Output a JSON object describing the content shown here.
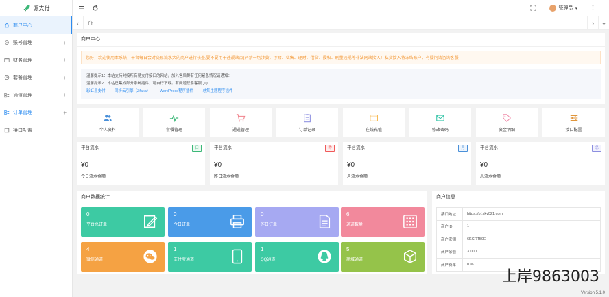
{
  "sidebar": {
    "logo": "源支付",
    "items": [
      {
        "label": "商户中心",
        "plus": ""
      },
      {
        "label": "账号管理",
        "plus": "+"
      },
      {
        "label": "财务管理",
        "plus": "+"
      },
      {
        "label": "套餐管理",
        "plus": "+"
      },
      {
        "label": "通道管理",
        "plus": "+"
      },
      {
        "label": "订单管理",
        "plus": "+"
      },
      {
        "label": "接口配置",
        "plus": ""
      }
    ]
  },
  "topbar": {
    "user": "管理员",
    "caret": "▾"
  },
  "tabbar": {
    "left": "‹",
    "right": "›",
    "down": "⌄"
  },
  "main": {
    "title": "商户中心",
    "notice": "您好，欢迎使用本系统，平台每日会对交易流水大的商户进行核查,要不要用于违规站点(严禁一切涉黄、涉赌、私售、理财、借贷、授权、刷量违规等非法网站接入！私货接入将冻结账户，有疑问请咨询客服",
    "tip1": "温馨提示1：本站支持对接所有易支付接口的网站，加入售后群有任何紧急情况请通知：",
    "tip2": "温馨提示2：本站已集成部分系统插件，可自行下载。有问题联系客服QQ：",
    "links": [
      "彩虹易支付",
      "同析云引擎（Zfaka）",
      "WordPress程序插件",
      "总集主题程序插件"
    ]
  },
  "quick": [
    {
      "label": "个人资料",
      "icon": "users-icon",
      "color": "#4a90d9"
    },
    {
      "label": "套餐管理",
      "icon": "pulse-icon",
      "color": "#3cb878"
    },
    {
      "label": "通道管理",
      "icon": "cart-icon",
      "color": "#f0808a"
    },
    {
      "label": "订单记录",
      "icon": "clipboard-icon",
      "color": "#8c8fe0"
    },
    {
      "label": "在线充值",
      "icon": "window-icon",
      "color": "#f5a623"
    },
    {
      "label": "修改密码",
      "icon": "mail-icon",
      "color": "#2fc4a6"
    },
    {
      "label": "资金明细",
      "icon": "tag-icon",
      "color": "#f08aa8"
    },
    {
      "label": "接口配置",
      "icon": "sliders-icon",
      "color": "#e0963c"
    }
  ],
  "stats": [
    {
      "title": "平台流水",
      "badge": "日",
      "badge_color": "#3cb878",
      "value": "¥0",
      "desc": "今日流水金额"
    },
    {
      "title": "平台流水",
      "badge": "昨",
      "badge_color": "#f05a5a",
      "value": "¥0",
      "desc": "昨日流水金额"
    },
    {
      "title": "平台流水",
      "badge": "月",
      "badge_color": "#4a90d9",
      "value": "¥0",
      "desc": "月流水金额"
    },
    {
      "title": "平台流水",
      "badge": "总",
      "badge_color": "#8c8fe0",
      "value": "¥0",
      "desc": "总流水金额"
    }
  ],
  "data_panel": {
    "title": "商户数据统计",
    "tiles": [
      {
        "num": "0",
        "label": "平台总订单",
        "color": "#3dcaa3",
        "icon": "edit-icon"
      },
      {
        "num": "0",
        "label": "今日订单",
        "color": "#4a9be8",
        "icon": "printer-icon"
      },
      {
        "num": "0",
        "label": "昨日订单",
        "color": "#a6a9f2",
        "icon": "document-icon"
      },
      {
        "num": "6",
        "label": "通道数量",
        "color": "#f2899c",
        "icon": "grid-icon"
      },
      {
        "num": "4",
        "label": "微信通道",
        "color": "#f5a243",
        "icon": "wechat-icon"
      },
      {
        "num": "1",
        "label": "支付宝通道",
        "color": "#3dcaa3",
        "icon": "tablet-icon"
      },
      {
        "num": "1",
        "label": "QQ通道",
        "color": "#3dcaa3",
        "icon": "qq-icon"
      },
      {
        "num": "5",
        "label": "商城通道",
        "color": "#95c34a",
        "icon": "box-icon"
      }
    ]
  },
  "info_panel": {
    "title": "商户信息",
    "rows": [
      {
        "key": "接口地址",
        "value": "https://pf.sky021.com"
      },
      {
        "key": "商户ID",
        "value": "1"
      },
      {
        "key": "商户密钥",
        "value": "6KCRT59E"
      },
      {
        "key": "商户余额",
        "value": "3.000"
      },
      {
        "key": "商户费率",
        "value": "0 %"
      }
    ]
  },
  "version": "Version 5.1.0",
  "watermark": "上岸9863003"
}
